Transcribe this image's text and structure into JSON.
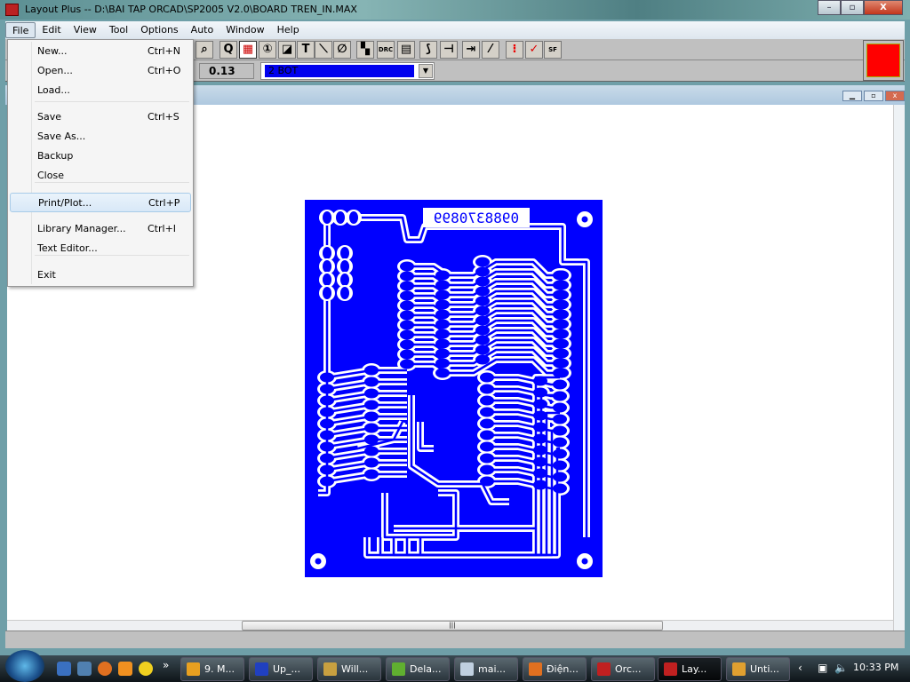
{
  "window": {
    "title": "Layout Plus -- D:\\BAI TAP ORCAD\\SP2005 V2.0\\BOARD TREN_IN.MAX",
    "minimize": "–",
    "maximize": "▫",
    "close": "X"
  },
  "menubar": [
    "File",
    "Edit",
    "View",
    "Tool",
    "Options",
    "Auto",
    "Window",
    "Help"
  ],
  "file_menu": [
    {
      "label": "New...",
      "shortcut": "Ctrl+N"
    },
    {
      "label": "Open...",
      "shortcut": "Ctrl+O"
    },
    {
      "label": "Load...",
      "shortcut": ""
    },
    {
      "label": "Save",
      "shortcut": "Ctrl+S"
    },
    {
      "label": "Save As...",
      "shortcut": ""
    },
    {
      "label": "Backup",
      "shortcut": ""
    },
    {
      "label": "Close",
      "shortcut": ""
    },
    {
      "label": "Print/Plot...",
      "shortcut": "Ctrl+P"
    },
    {
      "label": "Library Manager...",
      "shortcut": "Ctrl+I"
    },
    {
      "label": "Text Editor...",
      "shortcut": ""
    },
    {
      "label": "Exit",
      "shortcut": ""
    }
  ],
  "toolbar": [
    {
      "icon": "zoom-icon",
      "glyph": "⌕"
    },
    {
      "icon": "query-icon",
      "glyph": "Q"
    },
    {
      "icon": "component-icon",
      "glyph": "▦",
      "pressed": true
    },
    {
      "icon": "pin-icon",
      "glyph": "①"
    },
    {
      "icon": "obstacle-icon",
      "glyph": "◪"
    },
    {
      "icon": "text-icon",
      "glyph": "T"
    },
    {
      "icon": "connection-icon",
      "glyph": "⟍"
    },
    {
      "icon": "error-icon",
      "glyph": "∅"
    },
    {
      "icon": "color-icon",
      "glyph": "▚"
    },
    {
      "icon": "drc-box-icon",
      "glyph": "DRC"
    },
    {
      "icon": "spreadsheet-icon",
      "glyph": "▤"
    },
    {
      "icon": "edit-segment-icon",
      "glyph": "⟆"
    },
    {
      "icon": "add-via-icon",
      "glyph": "⊣"
    },
    {
      "icon": "shove-track-icon",
      "glyph": "⇥"
    },
    {
      "icon": "route-icon",
      "glyph": "⁄"
    },
    {
      "icon": "reconnect-icon",
      "glyph": "⁝"
    },
    {
      "icon": "online-drc-icon",
      "glyph": "✓"
    },
    {
      "icon": "sf-icon",
      "glyph": "SF"
    }
  ],
  "toolbar_row2": {
    "track_width": "0.13",
    "layer": "2  BOT"
  },
  "colors": {
    "active_layer": "#ff0000",
    "board": "#0000ff"
  },
  "board": {
    "silkscreen_text": "0988370899"
  },
  "taskbar": {
    "items": [
      {
        "label": "9. M...",
        "color": "#e8a020"
      },
      {
        "label": "Up_...",
        "color": "#2040c0"
      },
      {
        "label": "Will...",
        "color": "#c8a040"
      },
      {
        "label": "Dela...",
        "color": "#60b030"
      },
      {
        "label": "mai...",
        "color": "#c0d0e0"
      },
      {
        "label": "Điện...",
        "color": "#e07020"
      },
      {
        "label": "Orc...",
        "color": "#c02020"
      },
      {
        "label": "Lay...",
        "color": "#c02020",
        "active": true
      },
      {
        "label": "Unti...",
        "color": "#e0a030"
      }
    ],
    "overflow": "»",
    "tray_arrow": "‹",
    "clock": "10:33 PM"
  }
}
